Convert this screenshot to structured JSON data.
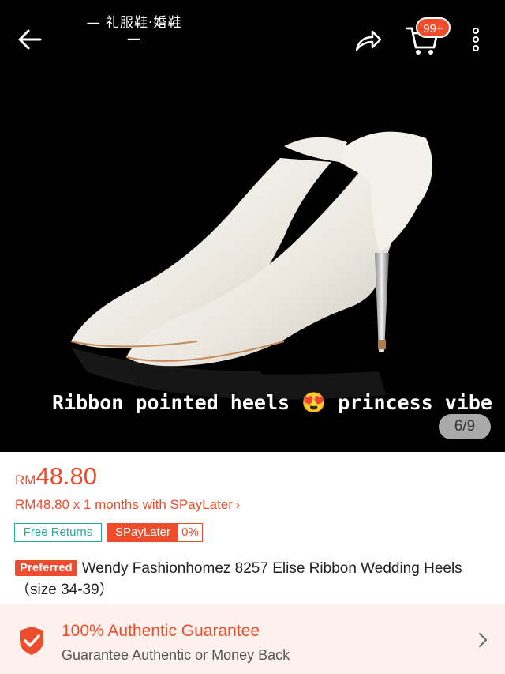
{
  "hero": {
    "watermark": "— 礼服鞋·婚鞋 —",
    "caption": "Ribbon pointed heels 😍 princess vibe",
    "counter": "6/9"
  },
  "topbar": {
    "back_icon": "arrow-left-icon",
    "share_icon": "share-icon",
    "cart_icon": "cart-icon",
    "cart_badge": "99+",
    "more_icon": "more-vertical-icon"
  },
  "product": {
    "currency": "RM",
    "price": "48.80",
    "paylater_prefix": "RM48.80 x 1 months with ",
    "paylater_brand": "SPayLater",
    "paylater_chevron": "›",
    "tag_returns": "Free Returns",
    "tag_spaylater": "SPayLater",
    "tag_spaylater_rate": "0%",
    "preferred_badge": "Preferred",
    "title": "Wendy Fashionhomez 8257 Elise Ribbon Wedding Heels （size 34-39）"
  },
  "guarantee": {
    "icon": "shield-check-icon",
    "title": "100% Authentic Guarantee",
    "subtitle": "Guarantee Authentic or Money Back",
    "chevron_icon": "chevron-right-icon"
  },
  "colors": {
    "accent": "#ee4d2d",
    "teal": "#26aa99",
    "guarantee_bg": "#fdf1ee"
  }
}
